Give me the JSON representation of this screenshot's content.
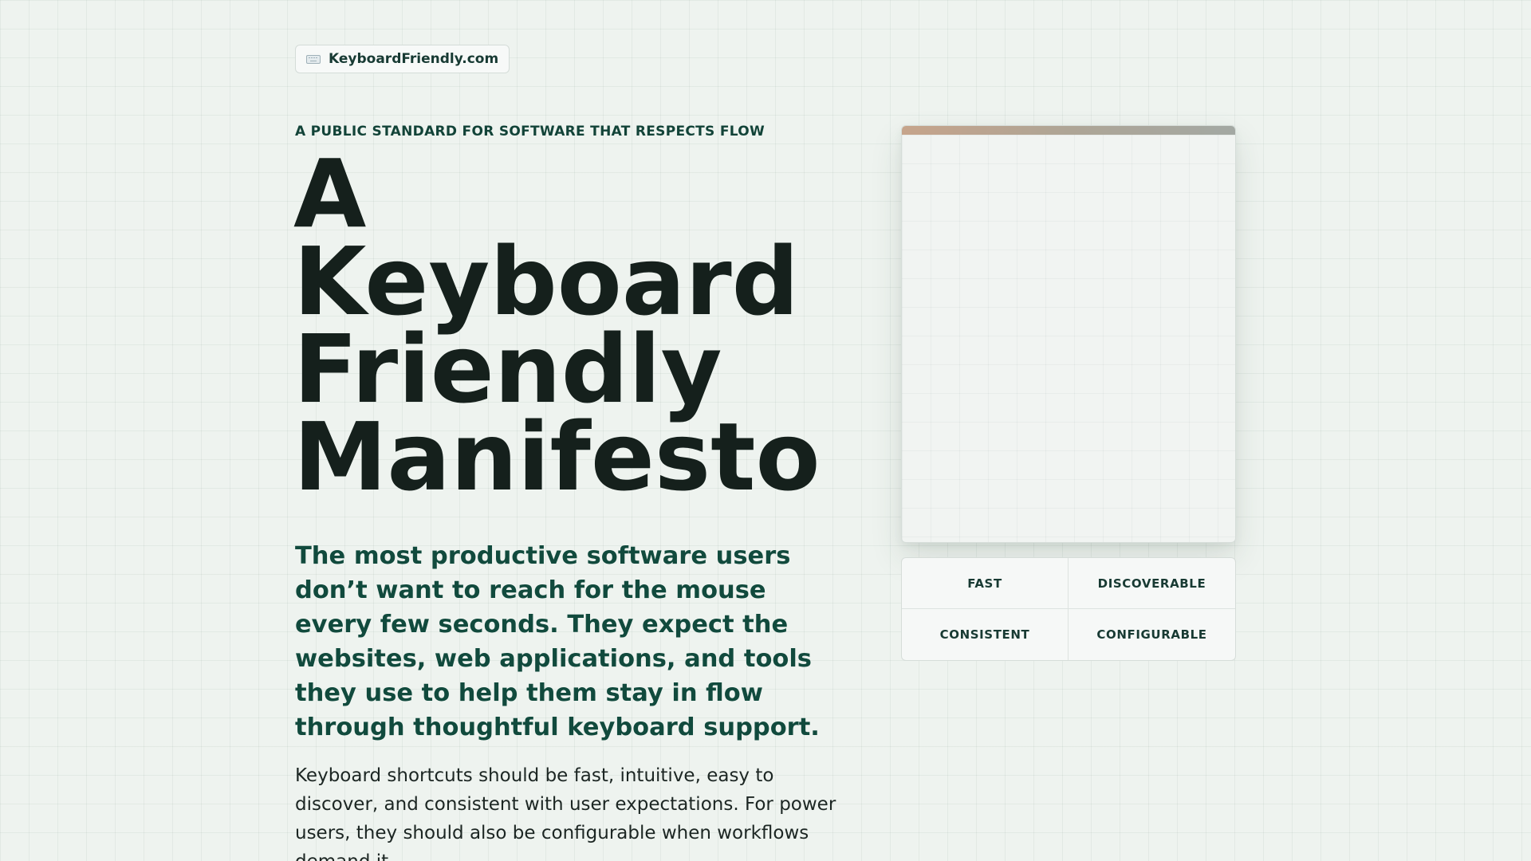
{
  "brand": {
    "icon": "keyboard-icon",
    "name": "KeyboardFriendly.com"
  },
  "hero": {
    "eyebrow": "A PUBLIC STANDARD FOR SOFTWARE THAT RESPECTS FLOW",
    "title_lines": [
      "A",
      "Keyboard",
      "Friendly",
      "Manifesto"
    ],
    "lede": "The most productive software users don’t want to reach for the mouse every few seconds. They expect the websites, web applications, and tools they use to help them stay in flow through thoughtful keyboard support.",
    "body": "Keyboard shortcuts should be fast, intuitive, easy to discover, and consistent with user expectations. For power users, they should also be configurable when workflows demand it."
  },
  "pillars": [
    {
      "label": "FAST"
    },
    {
      "label": "DISCOVERABLE"
    },
    {
      "label": "CONSISTENT"
    },
    {
      "label": "CONFIGURABLE"
    }
  ],
  "colors": {
    "background": "#eef3ef",
    "headline": "#15201c",
    "accent": "#114a3d",
    "panel_bar_start": "#c6a48b",
    "panel_bar_end": "#a3a8a3"
  }
}
